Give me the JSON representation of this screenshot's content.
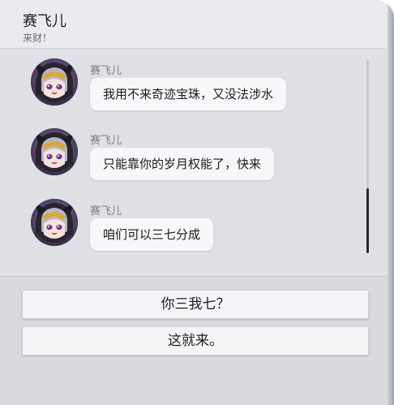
{
  "header": {
    "title": "赛飞儿",
    "subtitle": "来财！"
  },
  "messages": [
    {
      "sender": "赛飞儿",
      "text": "我用不来奇迹宝珠，又没法涉水"
    },
    {
      "sender": "赛飞儿",
      "text": "只能靠你的岁月权能了，快来"
    },
    {
      "sender": "赛飞儿",
      "text": "咱们可以三七分成"
    }
  ],
  "options": [
    {
      "label": "你三我七？"
    },
    {
      "label": "这就来。"
    }
  ],
  "scrollbar": {
    "position_fraction": 0.67
  },
  "colors": {
    "panel": "#e7e8ed",
    "bubble": "#f7f7f9",
    "scroll_thumb": "#2b2c30"
  }
}
